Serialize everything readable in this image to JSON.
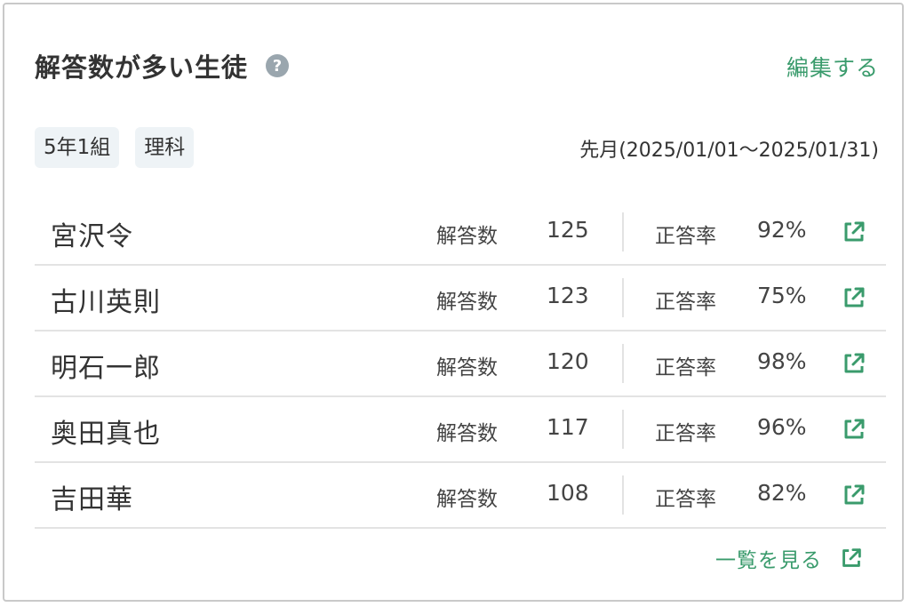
{
  "header": {
    "title": "解答数が多い生徒",
    "help_icon": "?",
    "edit_label": "編集する"
  },
  "tags": [
    "5年1組",
    "理科"
  ],
  "period": "先月(2025/01/01〜2025/01/31)",
  "labels": {
    "answers": "解答数",
    "correct_rate": "正答率"
  },
  "students": [
    {
      "name": "宮沢令",
      "answers": "125",
      "rate": "92%"
    },
    {
      "name": "古川英則",
      "answers": "123",
      "rate": "75%"
    },
    {
      "name": "明石一郎",
      "answers": "120",
      "rate": "98%"
    },
    {
      "name": "奥田真也",
      "answers": "117",
      "rate": "96%"
    },
    {
      "name": "吉田華",
      "answers": "108",
      "rate": "82%"
    }
  ],
  "footer": {
    "view_all_label": "一覧を見る"
  },
  "colors": {
    "accent": "#3a9b6c",
    "tag_bg": "#eef3f6",
    "help_icon": "#9aa6ae"
  },
  "icons": {
    "row_action": "external-link-icon",
    "help": "help-icon"
  }
}
